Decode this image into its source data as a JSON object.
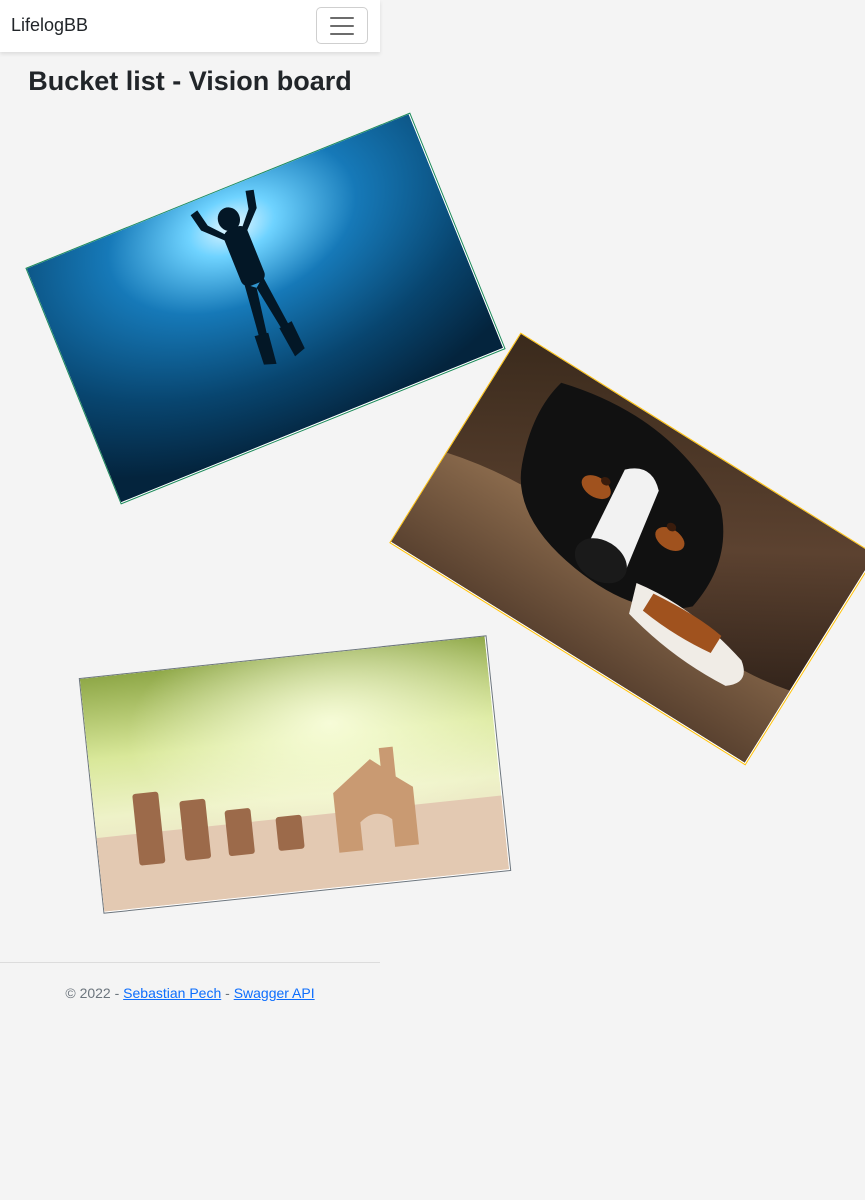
{
  "navbar": {
    "brand": "LifelogBB",
    "toggler_icon": "hamburger-menu-icon"
  },
  "page": {
    "title": "Bucket list - Vision board"
  },
  "vision_board": {
    "items": [
      {
        "subject": "scuba diver silhouette underwater",
        "border_color": "#1b8a5a"
      },
      {
        "subject": "bernese mountain dog resting on cushion",
        "border_color": "#ffc107"
      },
      {
        "subject": "stacked coins and wooden house",
        "border_color": "#6c757d"
      }
    ]
  },
  "footer": {
    "copyright": "© 2022 -",
    "author_link": "Sebastian Pech",
    "separator": "-",
    "api_link": "Swagger API"
  },
  "colors": {
    "background": "#f4f4f4",
    "link": "#0d6efd",
    "muted": "#6c757d"
  }
}
